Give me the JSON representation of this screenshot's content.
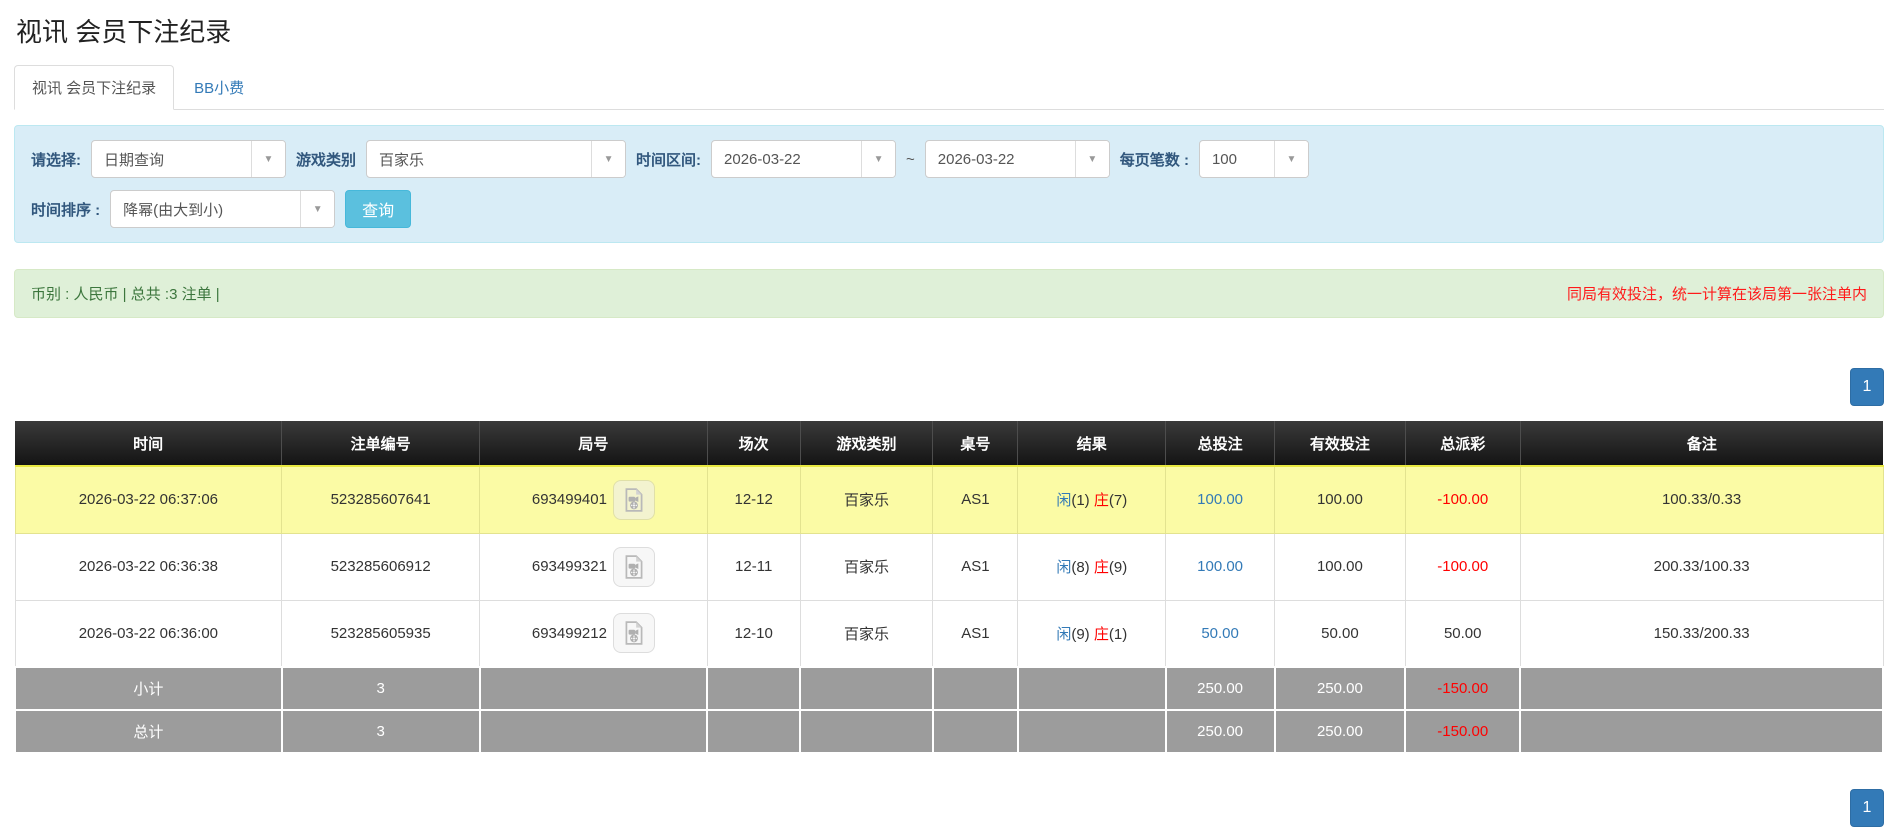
{
  "page": {
    "title": "视讯 会员下注纪录"
  },
  "tabs": [
    {
      "label": "视讯 会员下注纪录",
      "active": true
    },
    {
      "label": "BB小费",
      "active": false
    }
  ],
  "filters": {
    "select_label": "请选择:",
    "select_value": "日期查询",
    "game_type_label": "游戏类别",
    "game_type_value": "百家乐",
    "time_range_label": "时间区间:",
    "time_from": "2026-03-22",
    "tilde": "~",
    "time_to": "2026-03-22",
    "page_size_label": "每页笔数 :",
    "page_size_value": "100",
    "sort_label": "时间排序 :",
    "sort_value": "降幂(由大到小)",
    "search_button": "查询",
    "dropdown_arrow": "▼"
  },
  "summary": {
    "left": "币别 : 人民币 | 总共 :3 注单 |",
    "right": "同局有效投注，统一计算在该局第一张注单内"
  },
  "pagination": {
    "page": "1"
  },
  "colors": {
    "accent_blue": "#337ab7",
    "search_cyan": "#5bc0de",
    "highlight_row": "#fbfba5",
    "negative_red": "#ff0000",
    "totals_gray": "#9c9c9c",
    "panel_blue": "#d9edf7",
    "summary_green": "#dff0d8"
  },
  "table": {
    "headers": [
      "时间",
      "注单编号",
      "局号",
      "场次",
      "游戏类别",
      "桌号",
      "结果",
      "总投注",
      "有效投注",
      "总派彩",
      "备注"
    ],
    "rows": [
      {
        "time": "2026-03-22 06:37:06",
        "bet_id": "523285607641",
        "round_id": "693499401",
        "session": "12-12",
        "game": "百家乐",
        "table_no": "AS1",
        "result_player_label": "闲",
        "result_player_value": "(1)",
        "result_banker_label": "庄",
        "result_banker_value": "(7)",
        "total_bet": "100.00",
        "valid_bet": "100.00",
        "payout": "-100.00",
        "payout_negative": true,
        "remark": "100.33/0.33",
        "highlight": true
      },
      {
        "time": "2026-03-22 06:36:38",
        "bet_id": "523285606912",
        "round_id": "693499321",
        "session": "12-11",
        "game": "百家乐",
        "table_no": "AS1",
        "result_player_label": "闲",
        "result_player_value": "(8)",
        "result_banker_label": "庄",
        "result_banker_value": "(9)",
        "total_bet": "100.00",
        "valid_bet": "100.00",
        "payout": "-100.00",
        "payout_negative": true,
        "remark": "200.33/100.33",
        "highlight": false
      },
      {
        "time": "2026-03-22 06:36:00",
        "bet_id": "523285605935",
        "round_id": "693499212",
        "session": "12-10",
        "game": "百家乐",
        "table_no": "AS1",
        "result_player_label": "闲",
        "result_player_value": "(9)",
        "result_banker_label": "庄",
        "result_banker_value": "(1)",
        "total_bet": "50.00",
        "valid_bet": "50.00",
        "payout": "50.00",
        "payout_negative": false,
        "remark": "150.33/200.33",
        "highlight": false
      }
    ],
    "subtotal": {
      "label": "小计",
      "count": "3",
      "total_bet": "250.00",
      "valid_bet": "250.00",
      "payout": "-150.00",
      "payout_negative": true
    },
    "total": {
      "label": "总计",
      "count": "3",
      "total_bet": "250.00",
      "valid_bet": "250.00",
      "payout": "-150.00",
      "payout_negative": true
    }
  }
}
